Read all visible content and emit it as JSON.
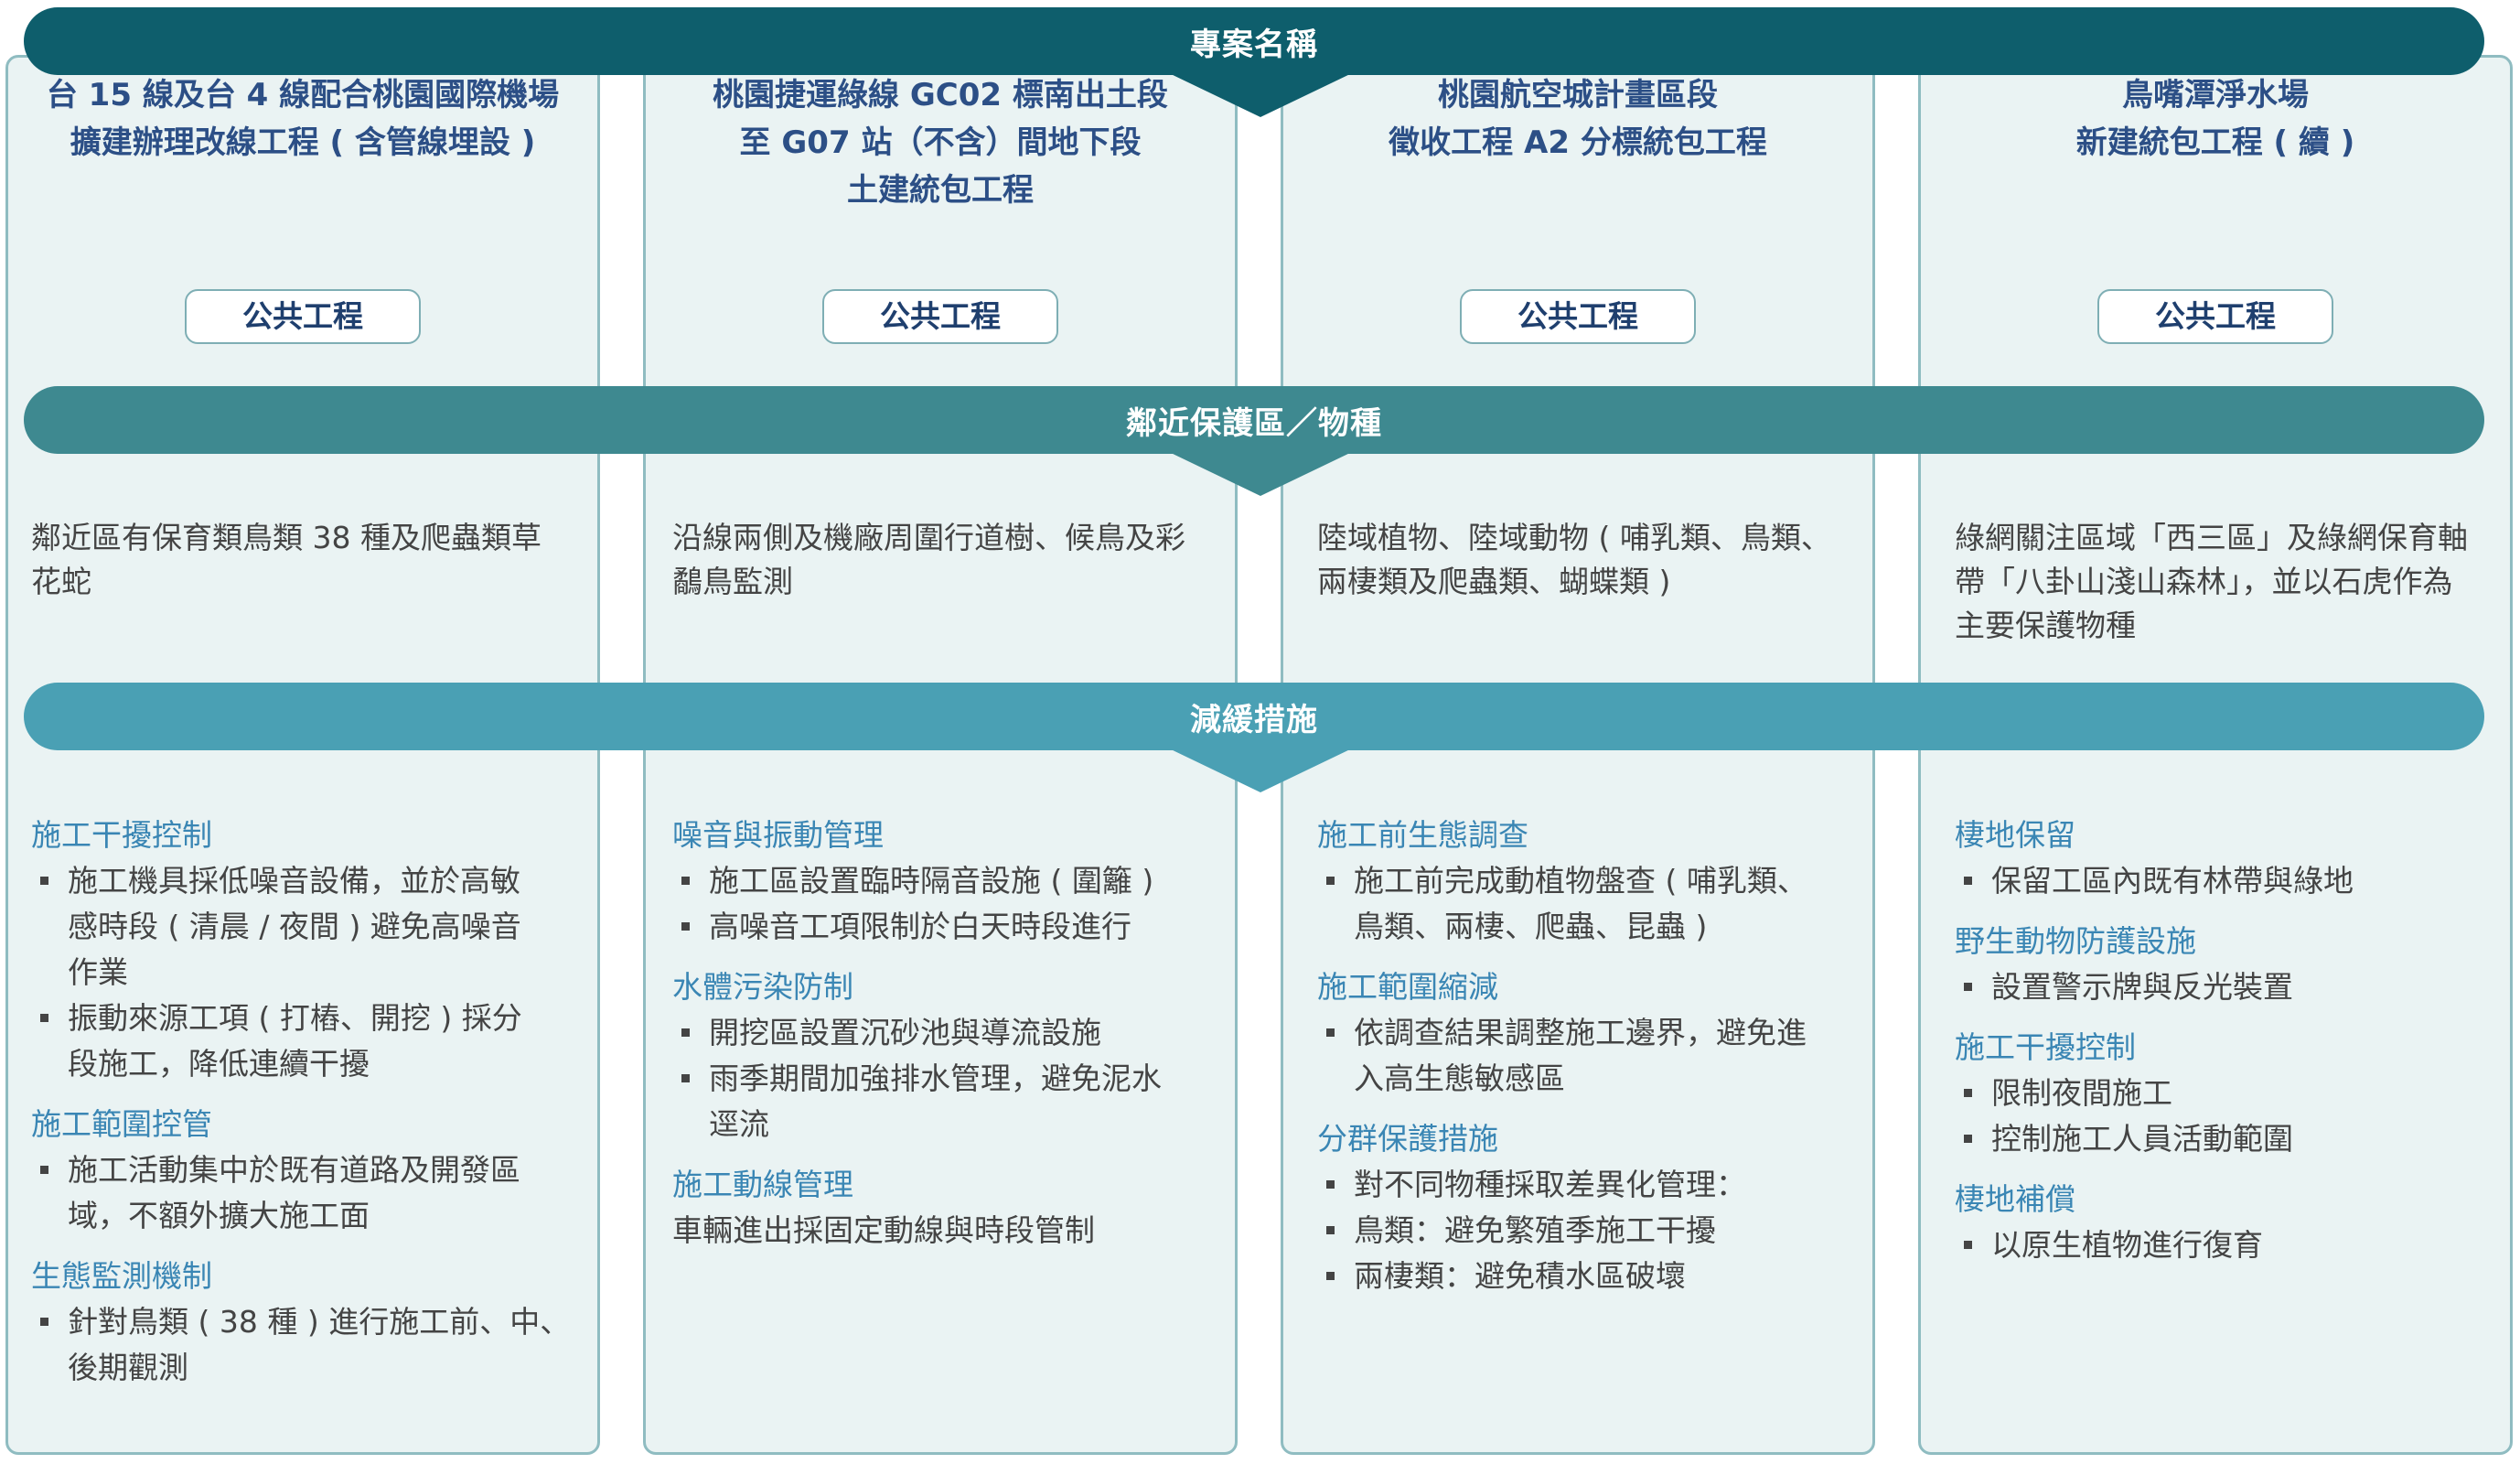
{
  "bands": {
    "project_name": "專案名稱",
    "protected_area": "鄰近保護區／物種",
    "mitigation": "減緩措施"
  },
  "colors": {
    "band_dark": "#0e5e6c",
    "band_mid": "#3e8990",
    "band_light": "#4aa0b4",
    "title_blue": "#2c4f86",
    "group_title_blue": "#3a86b4",
    "panel_bg": "#eaf3f3"
  },
  "projects": [
    {
      "title_lines": [
        "台 15 線及台 4 線配合桃園國際機場",
        "擴建辦理改線工程 ( 含管線埋設 )"
      ],
      "badge": "公共工程",
      "species_lines": [
        "鄰近區有保育類鳥類 38 種及爬蟲類草",
        "花蛇"
      ],
      "groups": [
        {
          "title": "施工干擾控制",
          "items": [
            [
              "施工機具採低噪音設備，並於高敏",
              "感時段 ( 清晨 / 夜間 ) 避免高噪音",
              "作業"
            ],
            [
              "振動來源工項 ( 打樁、開挖 ) 採分",
              "段施工，降低連續干擾"
            ]
          ]
        },
        {
          "title": "施工範圍控管",
          "items": [
            [
              "施工活動集中於既有道路及開發區",
              "域，不額外擴大施工面"
            ]
          ]
        },
        {
          "title": "生態監測機制",
          "items": [
            [
              "針對鳥類 ( 38 種 ) 進行施工前、中、",
              "後期觀測"
            ]
          ]
        }
      ]
    },
    {
      "title_lines": [
        "桃園捷運綠線 GC02 標南出土段",
        "至 G07 站（不含）間地下段",
        "土建統包工程"
      ],
      "badge": "公共工程",
      "species_lines": [
        "沿線兩側及機廠周圍行道樹、候鳥及彩",
        "鷸鳥監測"
      ],
      "groups": [
        {
          "title": "噪音與振動管理",
          "items": [
            [
              "施工區設置臨時隔音設施 ( 圍籬 )"
            ],
            [
              "高噪音工項限制於白天時段進行"
            ]
          ]
        },
        {
          "title": "水體污染防制",
          "items": [
            [
              "開挖區設置沉砂池與導流設施"
            ],
            [
              "雨季期間加強排水管理，避免泥水",
              "逕流"
            ]
          ]
        },
        {
          "title": "施工動線管理",
          "plain": "車輛進出採固定動線與時段管制"
        }
      ]
    },
    {
      "title_lines": [
        "桃園航空城計畫區段",
        "徵收工程 A2 分標統包工程"
      ],
      "badge": "公共工程",
      "species_lines": [
        "陸域植物、陸域動物 ( 哺乳類、鳥類、",
        "兩棲類及爬蟲類、蝴蝶類 )"
      ],
      "groups": [
        {
          "title": "施工前生態調查",
          "items": [
            [
              "施工前完成動植物盤查 ( 哺乳類、",
              "鳥類、兩棲、爬蟲、昆蟲 )"
            ]
          ]
        },
        {
          "title": "施工範圍縮減",
          "items": [
            [
              "依調查結果調整施工邊界，避免進",
              "入高生態敏感區"
            ]
          ]
        },
        {
          "title": "分群保護措施",
          "items": [
            [
              "對不同物種採取差異化管理："
            ],
            [
              "鳥類：避免繁殖季施工干擾"
            ],
            [
              "兩棲類：避免積水區破壞"
            ]
          ]
        }
      ]
    },
    {
      "title_lines": [
        "鳥嘴潭淨水場",
        "新建統包工程 ( 續 )"
      ],
      "badge": "公共工程",
      "species_lines": [
        "綠網關注區域「西三區」及綠網保育軸",
        "帶「八卦山淺山森林」，並以石虎作為",
        "主要保護物種"
      ],
      "groups": [
        {
          "title": "棲地保留",
          "items": [
            [
              "保留工區內既有林帶與綠地"
            ]
          ]
        },
        {
          "title": "野生動物防護設施",
          "items": [
            [
              "設置警示牌與反光裝置"
            ]
          ]
        },
        {
          "title": "施工干擾控制",
          "items": [
            [
              "限制夜間施工"
            ],
            [
              "控制施工人員活動範圍"
            ]
          ]
        },
        {
          "title": "棲地補償",
          "items": [
            [
              "以原生植物進行復育"
            ]
          ]
        }
      ]
    }
  ]
}
